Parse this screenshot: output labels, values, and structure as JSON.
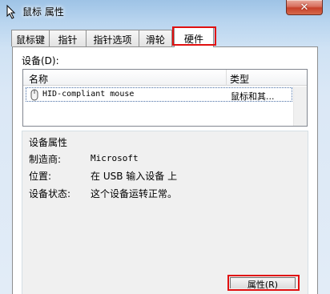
{
  "window": {
    "title": "鼠标 属性",
    "close_label": "✕",
    "icon": "mouse-pointer-icon"
  },
  "tabs": [
    {
      "label": "鼠标键",
      "active": false
    },
    {
      "label": "指针",
      "active": false
    },
    {
      "label": "指针选项",
      "active": false
    },
    {
      "label": "滑轮",
      "active": false
    },
    {
      "label": "硬件",
      "active": true
    }
  ],
  "devices": {
    "label": "设备(D):",
    "columns": [
      "名称",
      "类型"
    ],
    "rows": [
      {
        "name": "HID-compliant mouse",
        "type": "鼠标和其...",
        "icon": "mouse-device-icon"
      }
    ]
  },
  "properties": {
    "title": "设备属性",
    "manufacturer_label": "制造商:",
    "manufacturer_value": "Microsoft",
    "location_label": "位置:",
    "location_value": "在 USB 输入设备 上",
    "status_label": "设备状态:",
    "status_value": "这个设备运转正常。"
  },
  "buttons": {
    "properties_label": "属性(R)"
  },
  "highlight_color": "#e01010"
}
